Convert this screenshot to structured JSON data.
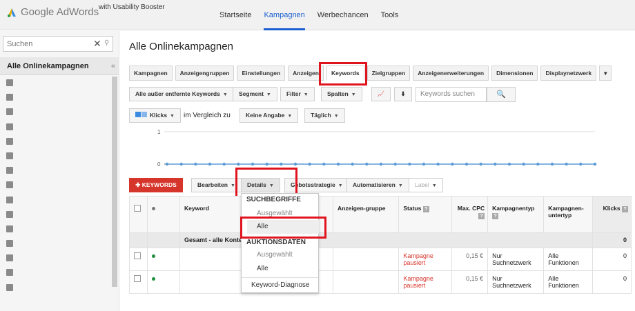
{
  "app": {
    "brand": "Google AdWords",
    "booster": "with Usability Booster"
  },
  "topnav": [
    "Startseite",
    "Kampagnen",
    "Werbechancen",
    "Tools"
  ],
  "sidebar": {
    "search_placeholder": "Suchen",
    "header": "Alle Onlinekampagnen"
  },
  "page_title": "Alle Onlinekampagnen",
  "tabs": [
    "Kampagnen",
    "Anzeigengruppen",
    "Einstellungen",
    "Anzeigen",
    "Keywords",
    "Zielgruppen",
    "Anzeigenerweiterungen",
    "Dimensionen",
    "Displaynetzwerk"
  ],
  "toolbar": {
    "filter_all": "Alle außer entfernte Keywords",
    "segment": "Segment",
    "filter": "Filter",
    "columns": "Spalten",
    "search_placeholder": "Keywords suchen"
  },
  "chartbar": {
    "metric": "Klicks",
    "compare_text": "im Vergleich zu",
    "compare_value": "Keine Angabe",
    "period": "Täglich"
  },
  "chart_data": {
    "type": "line",
    "y_ticks": [
      "1",
      "0"
    ],
    "ylim": [
      0,
      1
    ]
  },
  "actions": {
    "add": "KEYWORDS",
    "edit": "Bearbeiten",
    "details": "Details",
    "bid": "Gebotsstrategie",
    "automate": "Automatisieren",
    "label": "Label"
  },
  "table": {
    "headers": {
      "keyword": "Keyword",
      "adgroup": "Anzeigen-gruppe",
      "status": "Status",
      "maxcpc": "Max. CPC",
      "camptype": "Kampagnentyp",
      "subtype": "Kampagnen-untertyp",
      "clicks": "Klicks"
    },
    "total_label": "Gesamt - alle Konten",
    "total_clicks": "0",
    "rows": [
      {
        "status": "Kampagne pausiert",
        "cpc": "0,15 €",
        "type": "Nur Suchnetzwerk",
        "subtype": "Alle Funktionen",
        "clicks": "0"
      },
      {
        "status": "Kampagne pausiert",
        "cpc": "0,15 €",
        "type": "Nur Suchnetzwerk",
        "subtype": "Alle Funktionen",
        "clicks": "0"
      }
    ]
  },
  "dropdown": {
    "header1": "SUCHBEGRIFFE",
    "item1": "Ausgewählt",
    "item2": "Alle",
    "header2": "AUKTIONSDATEN",
    "item3": "Ausgewählt",
    "item4": "Alle",
    "item5": "Keyword-Diagnose"
  },
  "colors": {
    "accent": "#1a5fd0",
    "red": "#d6352b",
    "chart_line": "#5b9bd5"
  }
}
